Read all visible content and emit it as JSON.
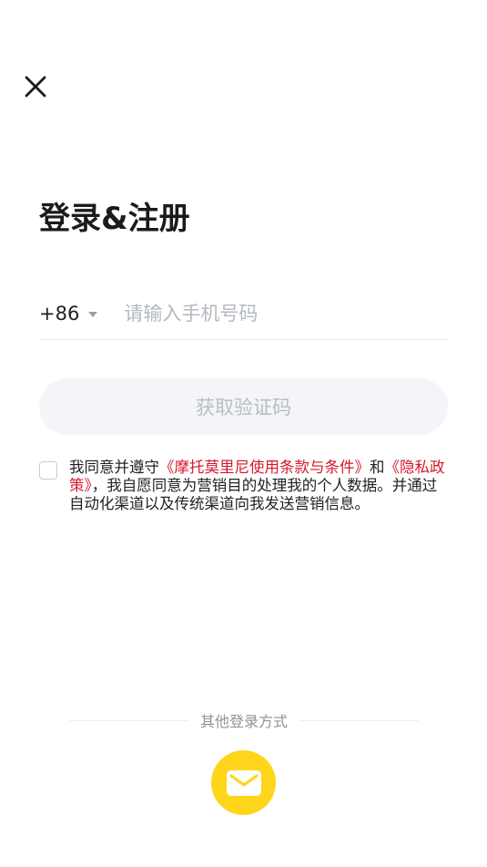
{
  "header": {
    "close_icon": "close-icon"
  },
  "title": "登录&注册",
  "phone": {
    "country_code": "+86",
    "placeholder": "请输入手机号码",
    "value": ""
  },
  "get_code_button": "获取验证码",
  "agreement": {
    "checked": false,
    "text_1": "我同意并遵守",
    "link_terms": "《摩托莫里尼使用条款与条件》",
    "text_2": "和",
    "link_privacy": "《隐私政策》",
    "text_3": "，我自愿同意为营销目的处理我的个人数据。并通过自动化渠道以及传统渠道向我发送营销信息。"
  },
  "other_login": {
    "label": "其他登录方式",
    "email_icon": "mail-icon"
  },
  "colors": {
    "accent_yellow": "#fed51b",
    "link_red": "#d3192a",
    "button_disabled_bg": "#f3f5f8",
    "button_disabled_text": "#b8bcc3"
  }
}
